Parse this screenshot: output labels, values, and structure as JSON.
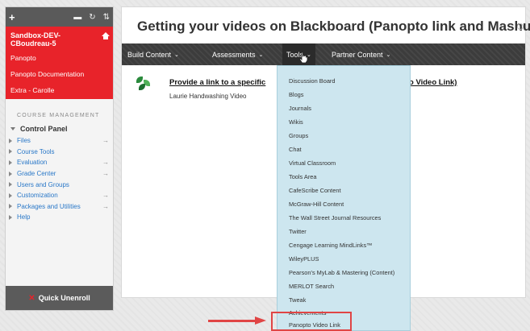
{
  "sidebar": {
    "toolbar_plus": "+",
    "course_name": "Sandbox-DEV-CBoudreau-5",
    "links": [
      "Panopto",
      "Panopto Documentation",
      "Extra - Carolle"
    ],
    "section_title": "COURSE MANAGEMENT",
    "panel_title": "Control Panel",
    "panel_items": [
      {
        "label": "Files",
        "has_arrow": true
      },
      {
        "label": "Course Tools",
        "has_arrow": false
      },
      {
        "label": "Evaluation",
        "has_arrow": true
      },
      {
        "label": "Grade Center",
        "has_arrow": true
      },
      {
        "label": "Users and Groups",
        "has_arrow": false
      },
      {
        "label": "Customization",
        "has_arrow": true
      },
      {
        "label": "Packages and Utilities",
        "has_arrow": true
      },
      {
        "label": "Help",
        "has_arrow": false
      }
    ],
    "quick_unenroll": "Quick Unenroll"
  },
  "main": {
    "title": "Getting your videos on Blackboard (Panopto link and Mashup)",
    "menus": [
      "Build Content",
      "Assessments",
      "Tools",
      "Partner Content"
    ],
    "content_item": {
      "title_start": "Provide a link to a specific",
      "title_end": "o Video Link)",
      "description": "Laurie Handwashing Video"
    }
  },
  "tools_menu": [
    "Discussion Board",
    "Blogs",
    "Journals",
    "Wikis",
    "Groups",
    "Chat",
    "Virtual Classroom",
    "Tools Area",
    "CafeScribe Content",
    "McGraw-Hill Content",
    "The Wall Street Journal Resources",
    "Twitter",
    "Cengage Learning MindLinks™",
    "WileyPLUS",
    "Pearson's MyLab & Mastering (Content)",
    "MERLOT Search",
    "Tweak",
    "Achievements",
    "Panopto Video Link"
  ],
  "colors": {
    "accent_red": "#e8232a",
    "action_bar": "#3c3c3c",
    "dropdown_bg": "#cde6ef",
    "link_blue": "#2a78c8",
    "annotation_red": "#e04545"
  }
}
